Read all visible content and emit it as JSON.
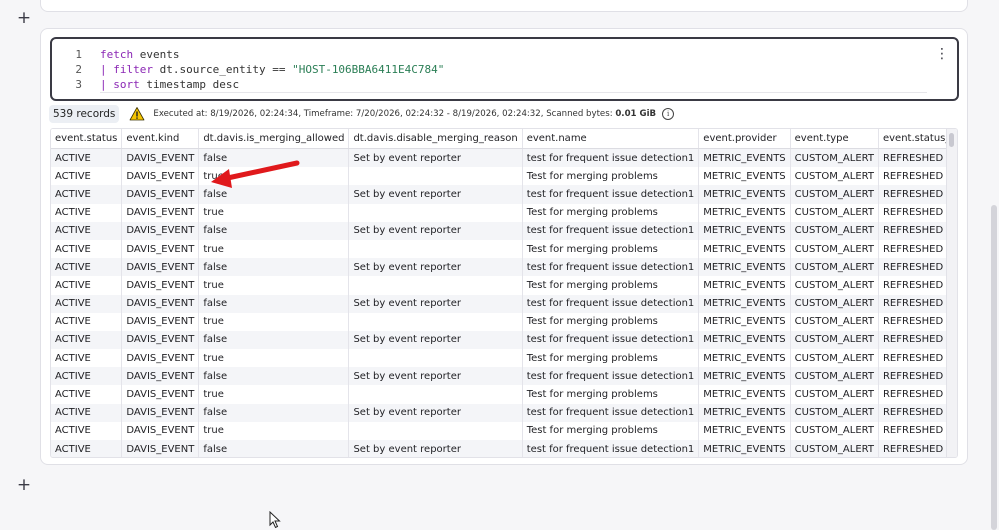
{
  "notebook": {
    "add_section_symbol": "+"
  },
  "editor": {
    "line_numbers": [
      "1",
      "2",
      "3"
    ],
    "lines": [
      {
        "pipe": "",
        "keyword": "fetch",
        "rest": " events",
        "string": ""
      },
      {
        "pipe": "| ",
        "keyword": "filter",
        "rest": " dt.source_entity == ",
        "string": "\"HOST-106BBA6411E4C784\""
      },
      {
        "pipe": "| ",
        "keyword": "sort",
        "rest": " timestamp desc",
        "string": ""
      }
    ],
    "menu_symbol": "⋮"
  },
  "status": {
    "records": "539 records",
    "executed_info": "Executed at: 8/19/2026, 02:24:34, Timeframe: 7/20/2026, 02:24:32 - 8/19/2026, 02:24:32, Scanned bytes: ",
    "scanned_bytes": "0.01 GiB",
    "info_symbol": "i"
  },
  "table": {
    "columns": [
      "event.status",
      "event.kind",
      "dt.davis.is_merging_allowed",
      "dt.davis.disable_merging_reason",
      "event.name",
      "event.provider",
      "event.type",
      "event.status_transition"
    ],
    "rows": [
      [
        "ACTIVE",
        "DAVIS_EVENT",
        "false",
        "Set by event reporter",
        "test for frequent issue detection1",
        "METRIC_EVENTS",
        "CUSTOM_ALERT",
        "REFRESHED"
      ],
      [
        "ACTIVE",
        "DAVIS_EVENT",
        "true",
        "",
        "Test for merging problems",
        "METRIC_EVENTS",
        "CUSTOM_ALERT",
        "REFRESHED"
      ],
      [
        "ACTIVE",
        "DAVIS_EVENT",
        "false",
        "Set by event reporter",
        "test for frequent issue detection1",
        "METRIC_EVENTS",
        "CUSTOM_ALERT",
        "REFRESHED"
      ],
      [
        "ACTIVE",
        "DAVIS_EVENT",
        "true",
        "",
        "Test for merging problems",
        "METRIC_EVENTS",
        "CUSTOM_ALERT",
        "REFRESHED"
      ],
      [
        "ACTIVE",
        "DAVIS_EVENT",
        "false",
        "Set by event reporter",
        "test for frequent issue detection1",
        "METRIC_EVENTS",
        "CUSTOM_ALERT",
        "REFRESHED"
      ],
      [
        "ACTIVE",
        "DAVIS_EVENT",
        "true",
        "",
        "Test for merging problems",
        "METRIC_EVENTS",
        "CUSTOM_ALERT",
        "REFRESHED"
      ],
      [
        "ACTIVE",
        "DAVIS_EVENT",
        "false",
        "Set by event reporter",
        "test for frequent issue detection1",
        "METRIC_EVENTS",
        "CUSTOM_ALERT",
        "REFRESHED"
      ],
      [
        "ACTIVE",
        "DAVIS_EVENT",
        "true",
        "",
        "Test for merging problems",
        "METRIC_EVENTS",
        "CUSTOM_ALERT",
        "REFRESHED"
      ],
      [
        "ACTIVE",
        "DAVIS_EVENT",
        "false",
        "Set by event reporter",
        "test for frequent issue detection1",
        "METRIC_EVENTS",
        "CUSTOM_ALERT",
        "REFRESHED"
      ],
      [
        "ACTIVE",
        "DAVIS_EVENT",
        "true",
        "",
        "Test for merging problems",
        "METRIC_EVENTS",
        "CUSTOM_ALERT",
        "REFRESHED"
      ],
      [
        "ACTIVE",
        "DAVIS_EVENT",
        "false",
        "Set by event reporter",
        "test for frequent issue detection1",
        "METRIC_EVENTS",
        "CUSTOM_ALERT",
        "REFRESHED"
      ],
      [
        "ACTIVE",
        "DAVIS_EVENT",
        "true",
        "",
        "Test for merging problems",
        "METRIC_EVENTS",
        "CUSTOM_ALERT",
        "REFRESHED"
      ],
      [
        "ACTIVE",
        "DAVIS_EVENT",
        "false",
        "Set by event reporter",
        "test for frequent issue detection1",
        "METRIC_EVENTS",
        "CUSTOM_ALERT",
        "REFRESHED"
      ],
      [
        "ACTIVE",
        "DAVIS_EVENT",
        "true",
        "",
        "Test for merging problems",
        "METRIC_EVENTS",
        "CUSTOM_ALERT",
        "REFRESHED"
      ],
      [
        "ACTIVE",
        "DAVIS_EVENT",
        "false",
        "Set by event reporter",
        "test for frequent issue detection1",
        "METRIC_EVENTS",
        "CUSTOM_ALERT",
        "REFRESHED"
      ],
      [
        "ACTIVE",
        "DAVIS_EVENT",
        "true",
        "",
        "Test for merging problems",
        "METRIC_EVENTS",
        "CUSTOM_ALERT",
        "REFRESHED"
      ],
      [
        "ACTIVE",
        "DAVIS_EVENT",
        "false",
        "Set by event reporter",
        "test for frequent issue detection1",
        "METRIC_EVENTS",
        "CUSTOM_ALERT",
        "REFRESHED"
      ]
    ]
  },
  "icons": {
    "warning": "warning-icon",
    "info": "info-icon",
    "annotation": "red-arrow",
    "cursor": "mouse-pointer-icon"
  },
  "colors": {
    "keyword": "#8b27b5",
    "string": "#2a7e55",
    "warning_fill": "#f5c400",
    "annotation_arrow": "#e0191c"
  }
}
